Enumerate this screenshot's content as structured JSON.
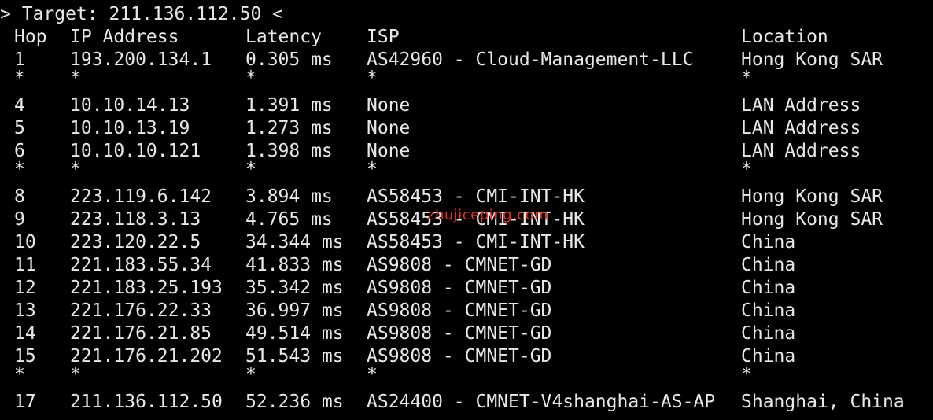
{
  "terminal": {
    "target_line": "> Target: 211.136.112.50 <",
    "headers": {
      "hop": "Hop",
      "ip": "IP Address",
      "latency": "Latency",
      "isp": "ISP",
      "location": "Location"
    },
    "rows": [
      {
        "hop": "1",
        "ip": "193.200.134.1",
        "latency": "0.305 ms",
        "isp": "AS42960 - Cloud-Management-LLC",
        "location": "Hong Kong SAR"
      },
      {
        "hop": "*",
        "ip": "*",
        "latency": "*",
        "isp": "*",
        "location": "*"
      },
      {
        "hop": "4",
        "ip": "10.10.14.13",
        "latency": "1.391 ms",
        "isp": "None",
        "location": "LAN Address"
      },
      {
        "hop": "5",
        "ip": "10.10.13.19",
        "latency": "1.273 ms",
        "isp": "None",
        "location": "LAN Address"
      },
      {
        "hop": "6",
        "ip": "10.10.10.121",
        "latency": "1.398 ms",
        "isp": "None",
        "location": "LAN Address"
      },
      {
        "hop": "*",
        "ip": "*",
        "latency": "*",
        "isp": "*",
        "location": "*"
      },
      {
        "hop": "8",
        "ip": "223.119.6.142",
        "latency": "3.894 ms",
        "isp": "AS58453 - CMI-INT-HK",
        "location": "Hong Kong SAR"
      },
      {
        "hop": "9",
        "ip": "223.118.3.13",
        "latency": "4.765 ms",
        "isp": "AS58453 - CMI-INT-HK",
        "location": "Hong Kong SAR"
      },
      {
        "hop": "10",
        "ip": "223.120.22.5",
        "latency": "34.344 ms",
        "isp": "AS58453 - CMI-INT-HK",
        "location": "China"
      },
      {
        "hop": "11",
        "ip": "221.183.55.34",
        "latency": "41.833 ms",
        "isp": "AS9808 - CMNET-GD",
        "location": "China"
      },
      {
        "hop": "12",
        "ip": "221.183.25.193",
        "latency": "35.342 ms",
        "isp": "AS9808 - CMNET-GD",
        "location": "China"
      },
      {
        "hop": "13",
        "ip": "221.176.22.33",
        "latency": "36.997 ms",
        "isp": "AS9808 - CMNET-GD",
        "location": "China"
      },
      {
        "hop": "14",
        "ip": "221.176.21.85",
        "latency": "49.514 ms",
        "isp": "AS9808 - CMNET-GD",
        "location": "China"
      },
      {
        "hop": "15",
        "ip": "221.176.21.202",
        "latency": "51.543 ms",
        "isp": "AS9808 - CMNET-GD",
        "location": "China"
      },
      {
        "hop": "*",
        "ip": "*",
        "latency": "*",
        "isp": "*",
        "location": "*"
      },
      {
        "hop": "17",
        "ip": "211.136.112.50",
        "latency": "52.236 ms",
        "isp": "AS24400 - CMNET-V4shanghai-AS-AP",
        "location": "Shanghai, China"
      }
    ],
    "watermark": "zhujiceping.com"
  },
  "colors": {
    "background": "#000000",
    "text": "#e8e8e8",
    "watermark": "#e0301e"
  }
}
